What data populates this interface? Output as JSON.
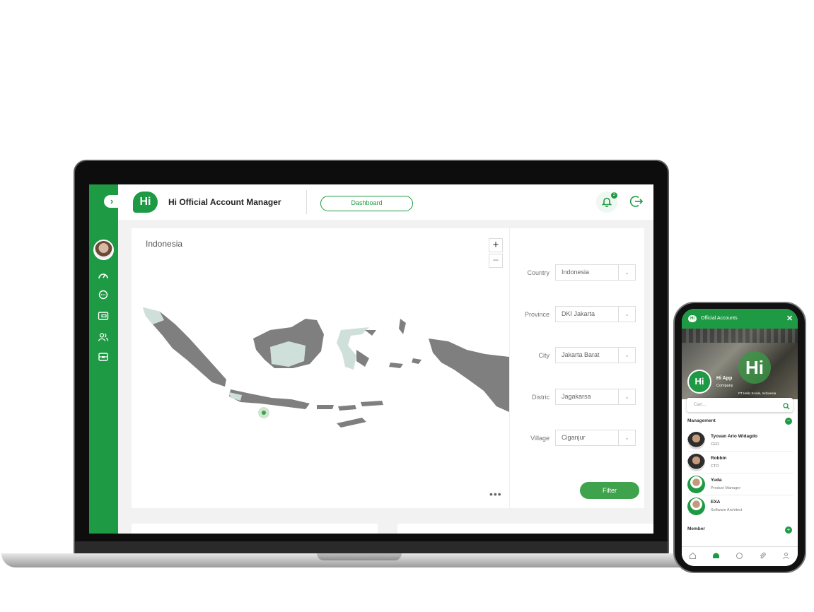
{
  "sidebar": {
    "toggle_icon": "chevron-right-icon",
    "icons": [
      "speedometer-icon",
      "chat-icon",
      "wallet-icon",
      "users-icon",
      "inbox-icon"
    ]
  },
  "topbar": {
    "logo_text": "Hi",
    "title": "Hi Official Account Manager",
    "dashboard_label": "Dashboard",
    "notification_count": "2"
  },
  "map": {
    "title": "Indonesia",
    "zoom_in": "+",
    "zoom_out": "−",
    "more": "•••"
  },
  "filters": {
    "country": {
      "label": "Country",
      "value": "Indonesia"
    },
    "province": {
      "label": "Province",
      "value": "DKI Jakarta"
    },
    "city": {
      "label": "City",
      "value": "Jakarta Barat"
    },
    "district": {
      "label": "Distric",
      "value": "Jagakarsa"
    },
    "village": {
      "label": "Village",
      "value": "Ciganjur"
    },
    "filter_label": "Filter"
  },
  "phone": {
    "header_title": "Official Accounts",
    "app_name": "Hi App",
    "app_type": "Company",
    "location": "PT Hello Xcode, Indonesia",
    "search_placeholder": "Cari...",
    "management_label": "Management",
    "member_label": "Member",
    "management": [
      {
        "name": "Tyovan Ario Widagdo",
        "role": "CEO"
      },
      {
        "name": "Robbin",
        "role": "CTO"
      },
      {
        "name": "Yuda",
        "role": "Product Manager"
      },
      {
        "name": "EXA",
        "role": "Software Architect"
      }
    ],
    "nav": [
      "home-icon",
      "company-icon",
      "chat-icon",
      "attachment-icon",
      "profile-icon"
    ],
    "accent": "#1d9a43"
  }
}
